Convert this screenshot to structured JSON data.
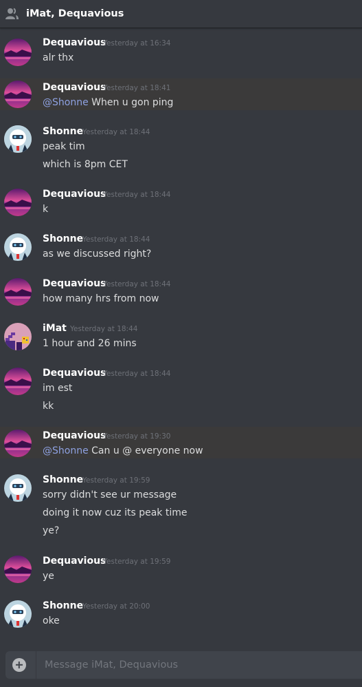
{
  "header": {
    "title": "iMat, Dequavious",
    "icon": "group-dm-icon"
  },
  "messages": [
    {
      "author": "Dequavious",
      "timestamp": "Yesterday at 16:34",
      "lines": [
        "alr thx"
      ],
      "avatar": "sunset-avatar"
    },
    {
      "author": "Dequavious",
      "timestamp": "Yesterday at 18:41",
      "mention": "@Shonne",
      "lines": [
        "When u gon ping"
      ],
      "avatar": "sunset-avatar",
      "highlighted": true
    },
    {
      "author": "Shonne",
      "timestamp": "Yesterday at 18:44",
      "lines": [
        "peak tim",
        "which is 8pm CET"
      ],
      "avatar": "robot-avatar"
    },
    {
      "author": "Dequavious",
      "timestamp": "Yesterday at 18:44",
      "lines": [
        "k"
      ],
      "avatar": "sunset-avatar"
    },
    {
      "author": "Shonne",
      "timestamp": "Yesterday at 18:44",
      "lines": [
        "as we discussed right?"
      ],
      "avatar": "robot-avatar"
    },
    {
      "author": "Dequavious",
      "timestamp": "Yesterday at 18:44",
      "lines": [
        "how many hrs from now"
      ],
      "avatar": "sunset-avatar"
    },
    {
      "author": "iMat",
      "timestamp": "Yesterday at 18:44",
      "lines": [
        "1 hour and 26 mins"
      ],
      "avatar": "pixel-avatar"
    },
    {
      "author": "Dequavious",
      "timestamp": "Yesterday at 18:44",
      "lines": [
        "im est",
        "kk"
      ],
      "avatar": "sunset-avatar"
    },
    {
      "author": "Dequavious",
      "timestamp": "Yesterday at 19:30",
      "mention": "@Shonne",
      "lines": [
        "Can u @ everyone now"
      ],
      "avatar": "sunset-avatar",
      "highlighted": true
    },
    {
      "author": "Shonne",
      "timestamp": "Yesterday at 19:59",
      "lines": [
        "sorry didn't see ur message",
        "doing it now cuz its peak time",
        "ye?"
      ],
      "avatar": "robot-avatar"
    },
    {
      "author": "Dequavious",
      "timestamp": "Yesterday at 19:59",
      "lines": [
        "ye"
      ],
      "avatar": "sunset-avatar"
    },
    {
      "author": "Shonne",
      "timestamp": "Yesterday at 20:00",
      "lines": [
        "oke"
      ],
      "avatar": "robot-avatar"
    }
  ],
  "composer": {
    "placeholder": "Message iMat, Dequavious",
    "add_icon": "plus-circle-icon"
  },
  "colors": {
    "background": "#36393f",
    "mention": "#8ea1e1",
    "highlight": "#3b3a3a",
    "input": "#40444b"
  }
}
